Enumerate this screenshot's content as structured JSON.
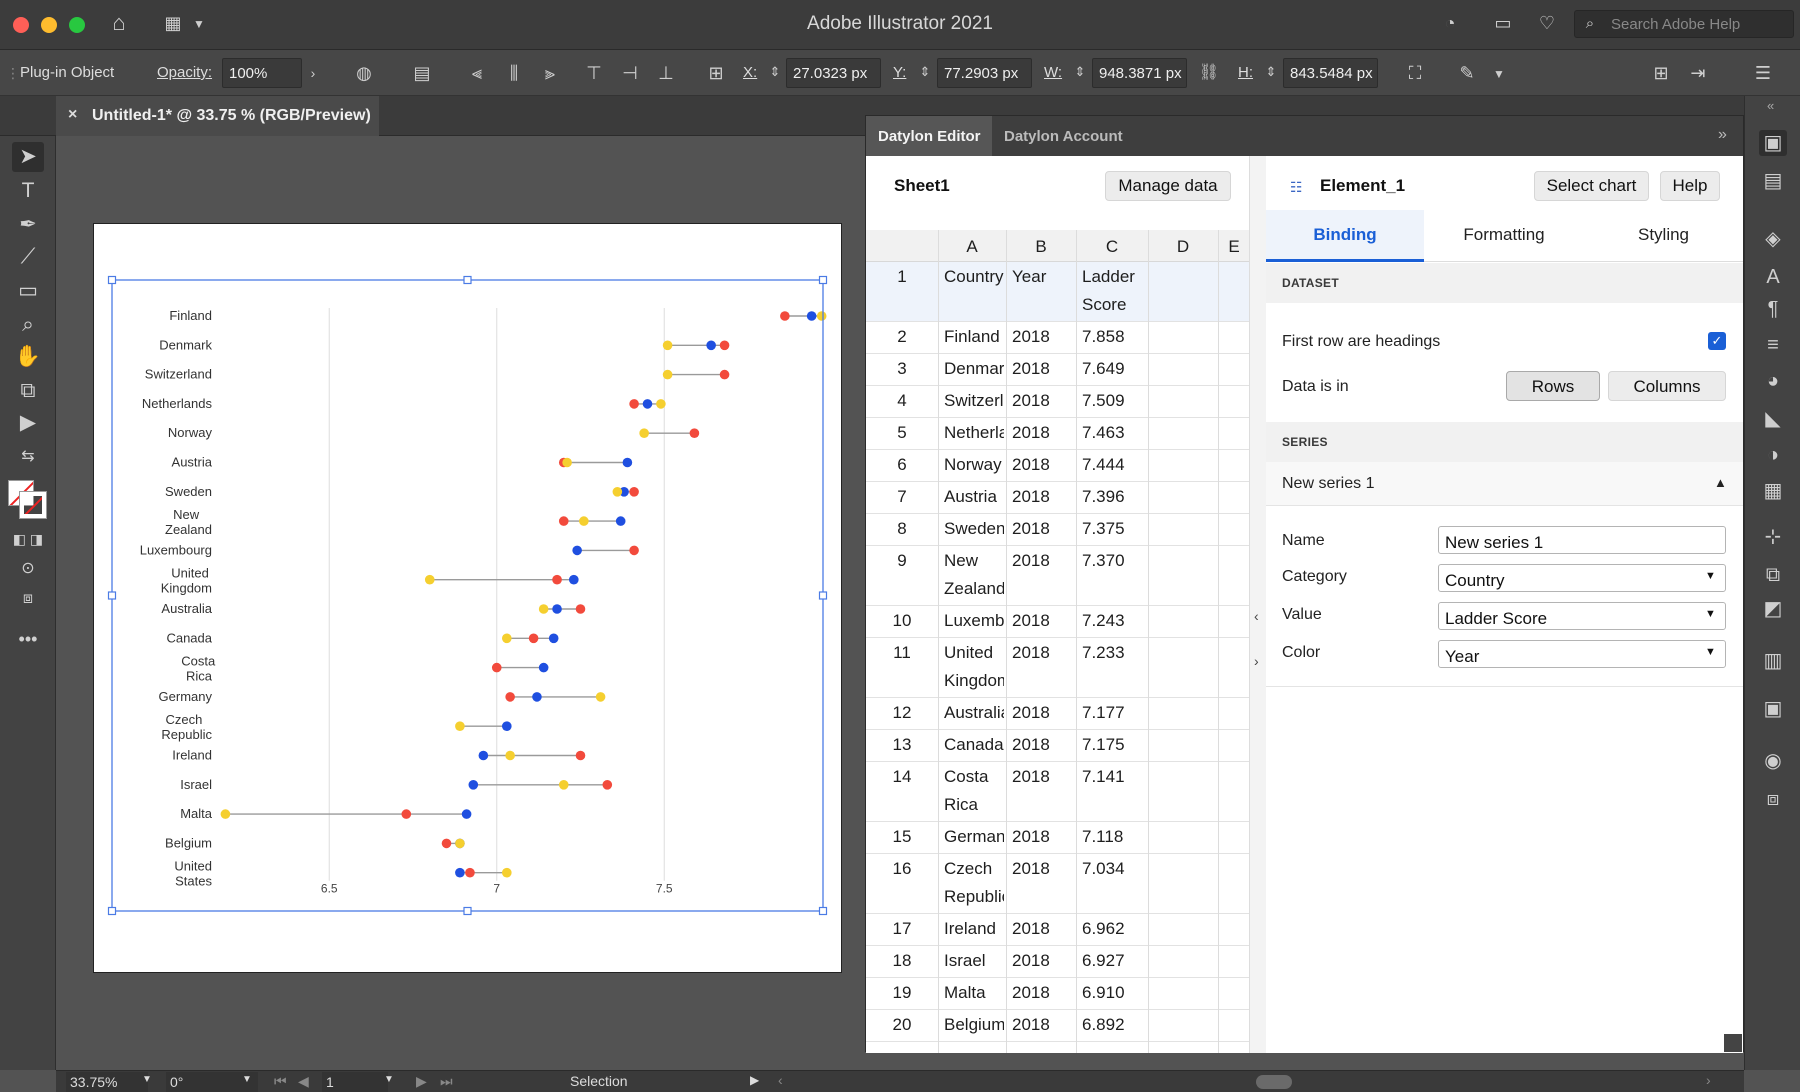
{
  "app": {
    "title": "Adobe Illustrator 2021",
    "search_placeholder": "Search Adobe Help"
  },
  "control_bar": {
    "object_type": "Plug-in Object",
    "opacity_label": "Opacity:",
    "opacity_value": "100%",
    "x_label": "X:",
    "x_value": "27.0323 px",
    "y_label": "Y:",
    "y_value": "77.2903 px",
    "w_label": "W:",
    "w_value": "948.3871 px",
    "h_label": "H:",
    "h_value": "843.5484 px"
  },
  "document_tab": {
    "title": "Untitled-1* @ 33.75 % (RGB/Preview)"
  },
  "status_bar": {
    "zoom": "33.75%",
    "rotation": "0°",
    "artboard": "1",
    "tool": "Selection"
  },
  "panel": {
    "tabs": [
      "Datylon Editor",
      "Datylon Account"
    ],
    "sheet_name": "Sheet1",
    "manage_button": "Manage data",
    "columns": [
      "A",
      "B",
      "C",
      "D",
      "E"
    ],
    "rows": [
      {
        "n": "1",
        "a": [
          "Country"
        ],
        "b": "Year",
        "c": [
          "Ladder",
          "Score"
        ]
      },
      {
        "n": "2",
        "a": [
          "Finland"
        ],
        "b": "2018",
        "c": [
          "7.858"
        ]
      },
      {
        "n": "3",
        "a": [
          "Denmark"
        ],
        "b": "2018",
        "c": [
          "7.649"
        ]
      },
      {
        "n": "4",
        "a": [
          "Switzerland"
        ],
        "b": "2018",
        "c": [
          "7.509"
        ]
      },
      {
        "n": "5",
        "a": [
          "Netherlands"
        ],
        "b": "2018",
        "c": [
          "7.463"
        ]
      },
      {
        "n": "6",
        "a": [
          "Norway"
        ],
        "b": "2018",
        "c": [
          "7.444"
        ]
      },
      {
        "n": "7",
        "a": [
          "Austria"
        ],
        "b": "2018",
        "c": [
          "7.396"
        ]
      },
      {
        "n": "8",
        "a": [
          "Sweden"
        ],
        "b": "2018",
        "c": [
          "7.375"
        ]
      },
      {
        "n": "9",
        "a": [
          "New",
          "Zealand"
        ],
        "b": "2018",
        "c": [
          "7.370"
        ]
      },
      {
        "n": "10",
        "a": [
          "Luxembourg"
        ],
        "b": "2018",
        "c": [
          "7.243"
        ]
      },
      {
        "n": "11",
        "a": [
          "United",
          "Kingdom"
        ],
        "b": "2018",
        "c": [
          "7.233"
        ]
      },
      {
        "n": "12",
        "a": [
          "Australia"
        ],
        "b": "2018",
        "c": [
          "7.177"
        ]
      },
      {
        "n": "13",
        "a": [
          "Canada"
        ],
        "b": "2018",
        "c": [
          "7.175"
        ]
      },
      {
        "n": "14",
        "a": [
          "Costa",
          "Rica"
        ],
        "b": "2018",
        "c": [
          "7.141"
        ]
      },
      {
        "n": "15",
        "a": [
          "Germany"
        ],
        "b": "2018",
        "c": [
          "7.118"
        ]
      },
      {
        "n": "16",
        "a": [
          "Czech",
          "Republic"
        ],
        "b": "2018",
        "c": [
          "7.034"
        ]
      },
      {
        "n": "17",
        "a": [
          "Ireland"
        ],
        "b": "2018",
        "c": [
          "6.962"
        ]
      },
      {
        "n": "18",
        "a": [
          "Israel"
        ],
        "b": "2018",
        "c": [
          "6.927"
        ]
      },
      {
        "n": "19",
        "a": [
          "Malta"
        ],
        "b": "2018",
        "c": [
          "6.910"
        ]
      },
      {
        "n": "20",
        "a": [
          "Belgium"
        ],
        "b": "2018",
        "c": [
          "6.892"
        ]
      }
    ],
    "element_name": "Element_1",
    "select_chart_button": "Select chart",
    "help_button": "Help",
    "sub_tabs": [
      "Binding",
      "Formatting",
      "Styling"
    ],
    "dataset_heading": "DATASET",
    "first_row_label": "First row are headings",
    "first_row_checked": true,
    "data_in_label": "Data is in",
    "rows_button": "Rows",
    "columns_button": "Columns",
    "series_heading": "SERIES",
    "series_title": "New series 1",
    "name_label": "Name",
    "name_value": "New series 1",
    "category_label": "Category",
    "category_value": "Country",
    "value_label": "Value",
    "value_value": "Ladder Score",
    "color_label": "Color",
    "color_value": "Year"
  },
  "chart_data": {
    "type": "scatter",
    "subtype": "dumbbell",
    "categories": [
      "Finland",
      "Denmark",
      "Switzerland",
      "Netherlands",
      "Norway",
      "Austria",
      "Sweden",
      "New Zealand",
      "Luxembourg",
      "United Kingdom",
      "Australia",
      "Canada",
      "Costa Rica",
      "Germany",
      "Czech Republic",
      "Ireland",
      "Israel",
      "Malta",
      "Belgium",
      "United States"
    ],
    "xticks": [
      6.5,
      7,
      7.5
    ],
    "xlim": [
      6.15,
      7.95
    ],
    "grid": true,
    "series": [
      {
        "color": "#f24a3c",
        "values": [
          7.86,
          7.68,
          7.68,
          7.41,
          7.59,
          7.2,
          7.41,
          7.2,
          7.41,
          7.18,
          7.25,
          7.11,
          7.0,
          7.04,
          null,
          7.25,
          7.33,
          6.73,
          6.85,
          6.92
        ]
      },
      {
        "color": "#1f4fe0",
        "values": [
          7.94,
          7.64,
          null,
          7.45,
          null,
          7.39,
          7.38,
          7.37,
          7.24,
          7.23,
          7.18,
          7.17,
          7.14,
          7.12,
          7.03,
          6.96,
          6.93,
          6.91,
          6.89,
          6.89
        ]
      },
      {
        "color": "#f5cf2f",
        "values": [
          7.97,
          7.51,
          7.51,
          7.49,
          7.44,
          7.21,
          7.36,
          7.26,
          null,
          6.8,
          7.14,
          7.03,
          null,
          7.31,
          6.89,
          7.04,
          7.2,
          6.19,
          6.89,
          7.03
        ]
      }
    ]
  }
}
